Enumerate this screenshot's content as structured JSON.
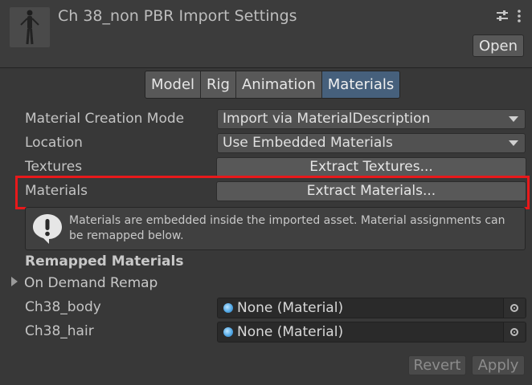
{
  "header": {
    "title": "Ch 38_non PBR Import Settings",
    "open_label": "Open",
    "icons": [
      "model-thumbnail",
      "preset-sliders-icon",
      "kebab-menu-icon"
    ]
  },
  "tabs": [
    {
      "label": "Model",
      "active": false
    },
    {
      "label": "Rig",
      "active": false
    },
    {
      "label": "Animation",
      "active": false
    },
    {
      "label": "Materials",
      "active": true
    }
  ],
  "fields": {
    "material_creation_mode": {
      "label": "Material Creation Mode",
      "value": "Import via MaterialDescription"
    },
    "location": {
      "label": "Location",
      "value": "Use Embedded Materials"
    },
    "textures": {
      "label": "Textures",
      "button": "Extract Textures..."
    },
    "materials": {
      "label": "Materials",
      "button": "Extract Materials..."
    }
  },
  "help": {
    "icon": "warning-exclamation-icon",
    "text": "Materials are embedded inside the imported asset. Material assignments can be remapped below."
  },
  "remapped": {
    "title": "Remapped Materials",
    "foldout": "On Demand Remap",
    "items": [
      {
        "label": "Ch38_body",
        "value": "None (Material)"
      },
      {
        "label": "Ch38_hair",
        "value": "None (Material)"
      }
    ]
  },
  "footer": {
    "revert_label": "Revert",
    "apply_label": "Apply"
  },
  "colors": {
    "highlight": "#e8191b",
    "active_tab": "#46607c",
    "background": "#383838"
  }
}
